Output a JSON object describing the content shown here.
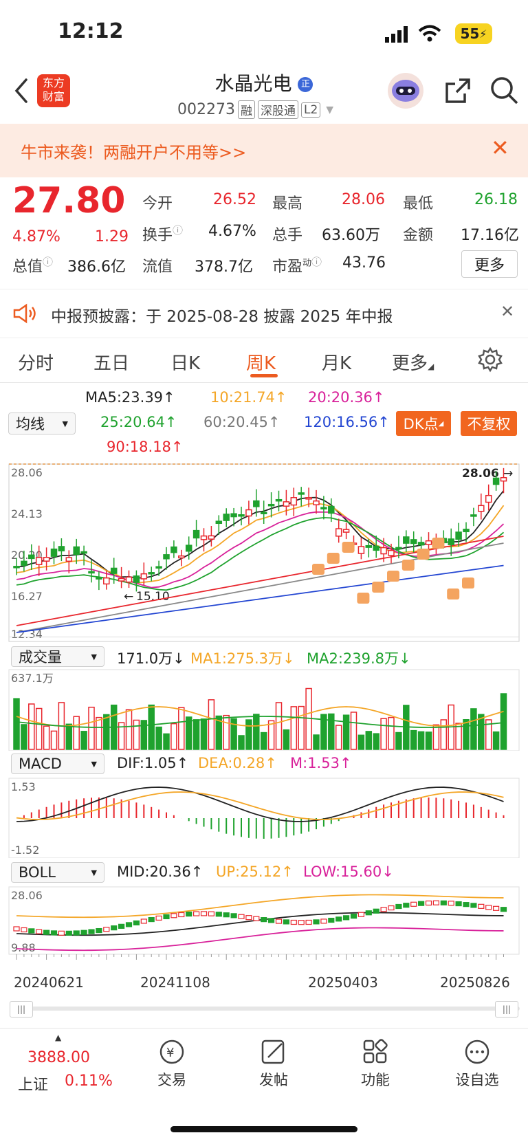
{
  "status_bar": {
    "time": "12:12",
    "battery": "55"
  },
  "header": {
    "logo_line1": "东方",
    "logo_line2": "财富",
    "stock_name": "水晶光电",
    "name_badge": "正",
    "stock_code": "002273",
    "tags": [
      "融",
      "深股通",
      "L2"
    ]
  },
  "banner": {
    "text": "牛市来袭！两融开户不用等>>"
  },
  "quote": {
    "price": "27.80",
    "change_pct": "4.87%",
    "change_amt": "1.29",
    "open_label": "今开",
    "open": "26.52",
    "high_label": "最高",
    "high": "28.06",
    "low_label": "最低",
    "low": "26.18",
    "turnover_label": "换手",
    "turnover": "4.67%",
    "volume_label": "总手",
    "volume": "63.60万",
    "amount_label": "金额",
    "amount": "17.16亿",
    "mktcap_label": "总值",
    "mktcap": "386.6亿",
    "float_label": "流值",
    "float_cap": "378.7亿",
    "pe_label": "市盈",
    "pe_sup": "动",
    "pe": "43.76",
    "more_button": "更多"
  },
  "notice": {
    "text": "中报预披露：于 2025-08-28 披露 2025 年中报"
  },
  "tabs": [
    "分时",
    "五日",
    "日K",
    "周K",
    "月K",
    "更多"
  ],
  "active_tab": "周K",
  "ma_panel": {
    "selector": "均线",
    "ma5": "MA5:23.39",
    "ma10": "10:21.74",
    "ma20": "20:20.36",
    "ma25": "25:20.64",
    "ma60": "60:20.45",
    "ma120": "120:16.56",
    "ma90": "90:18.18",
    "dk_button": "DK点",
    "adjust_button": "不复权"
  },
  "kline": {
    "y_labels": [
      "28.06",
      "24.13",
      "20.20",
      "16.27",
      "12.34"
    ],
    "max_label": "28.06",
    "min_label": "15.10"
  },
  "volume_panel": {
    "selector": "成交量",
    "value": "171.0万",
    "ma1": "MA1:275.3万",
    "ma2": "MA2:239.8万",
    "y_max": "637.1万"
  },
  "macd_panel": {
    "selector": "MACD",
    "dif": "DIF:1.05",
    "dea": "DEA:0.28",
    "m": "M:1.53",
    "y_max": "1.53",
    "y_min": "-1.52"
  },
  "boll_panel": {
    "selector": "BOLL",
    "mid": "MID:20.36",
    "up": "UP:25.12",
    "low": "LOW:15.60",
    "y_max": "28.06",
    "y_min": "9.88"
  },
  "x_dates": [
    "20240621",
    "20241108",
    "20250403",
    "20250826"
  ],
  "bottom_nav": {
    "index_value": "3888.00",
    "index_name": "上证",
    "index_change": "0.11%",
    "items": [
      "交易",
      "发帖",
      "功能",
      "设自选"
    ]
  },
  "colors": {
    "up": "#e8262d",
    "down": "#1fa22e",
    "accent": "#ec5b20",
    "ma10": "#f4a627",
    "ma20": "#d8219a",
    "ma120": "#2346d2"
  }
}
